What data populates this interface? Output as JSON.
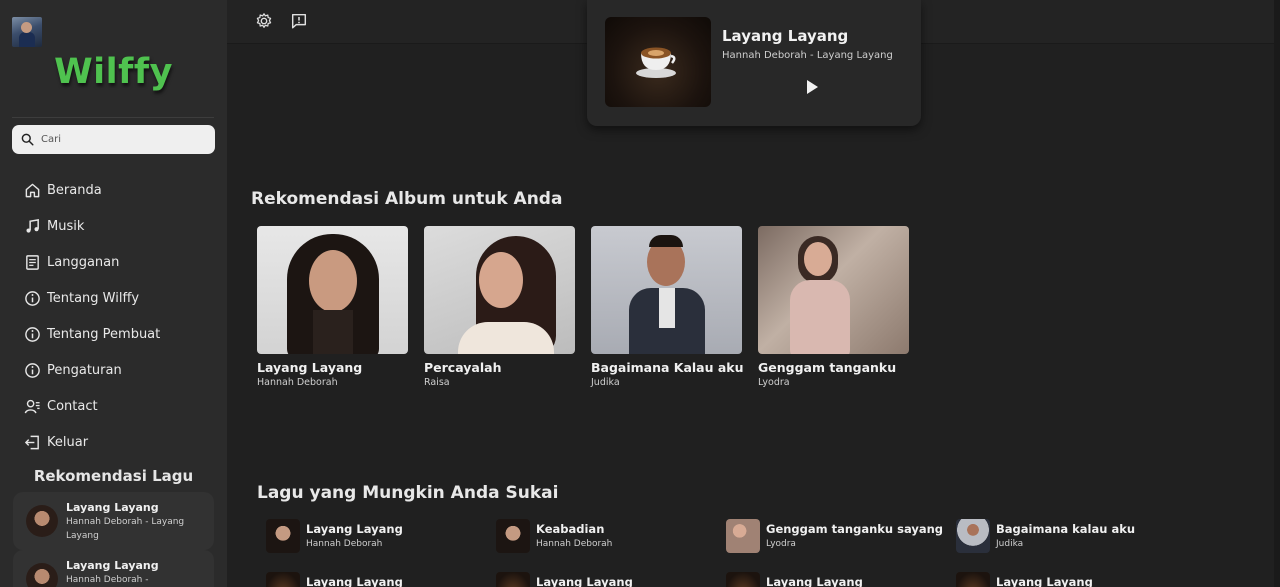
{
  "sidebar": {
    "logo": "Wilffy",
    "search_placeholder": "Cari",
    "nav": [
      {
        "label": "Beranda",
        "icon": "home-icon"
      },
      {
        "label": "Musik",
        "icon": "music-note-icon"
      },
      {
        "label": "Langganan",
        "icon": "document-icon"
      },
      {
        "label": "Tentang Wilffy",
        "icon": "info-icon"
      },
      {
        "label": "Tentang Pembuat",
        "icon": "info-icon"
      },
      {
        "label": "Pengaturan",
        "icon": "info-icon"
      },
      {
        "label": "Contact",
        "icon": "contact-icon"
      },
      {
        "label": "Keluar",
        "icon": "logout-icon"
      }
    ],
    "recommend_title": "Rekomendasi Lagu",
    "recommend": [
      {
        "title": "Layang Layang",
        "subtitle": "Hannah Deborah - Layang Layang"
      },
      {
        "title": "Layang Layang",
        "subtitle": "Hannah Deborah -"
      }
    ]
  },
  "player": {
    "title": "Layang Layang",
    "subtitle": "Hannah Deborah - Layang Layang"
  },
  "albums_title": "Rekomendasi Album untuk Anda",
  "albums": [
    {
      "name": "Layang Layang",
      "artist": "Hannah Deborah"
    },
    {
      "name": "Percayalah",
      "artist": "Raisa"
    },
    {
      "name": "Bagaimana Kalau aku",
      "artist": "Judika"
    },
    {
      "name": "Genggam tanganku",
      "artist": "Lyodra"
    }
  ],
  "songs_title": "Lagu yang Mungkin Anda Sukai",
  "songs": [
    {
      "name": "Layang Layang",
      "artist": "Hannah Deborah"
    },
    {
      "name": "Keabadian",
      "artist": "Hannah Deborah"
    },
    {
      "name": "Genggam tanganku sayang",
      "artist": "Lyodra"
    },
    {
      "name": "Bagaimana kalau aku",
      "artist": "Judika"
    },
    {
      "name": "Layang Layang",
      "artist": ""
    },
    {
      "name": "Layang Layang",
      "artist": ""
    },
    {
      "name": "Layang Layang",
      "artist": ""
    },
    {
      "name": "Layang Layang",
      "artist": ""
    }
  ],
  "colors": {
    "background": "#202020",
    "sidebar": "#2b2b2b",
    "logo": "#4fc24f",
    "topbar": "#232323"
  }
}
